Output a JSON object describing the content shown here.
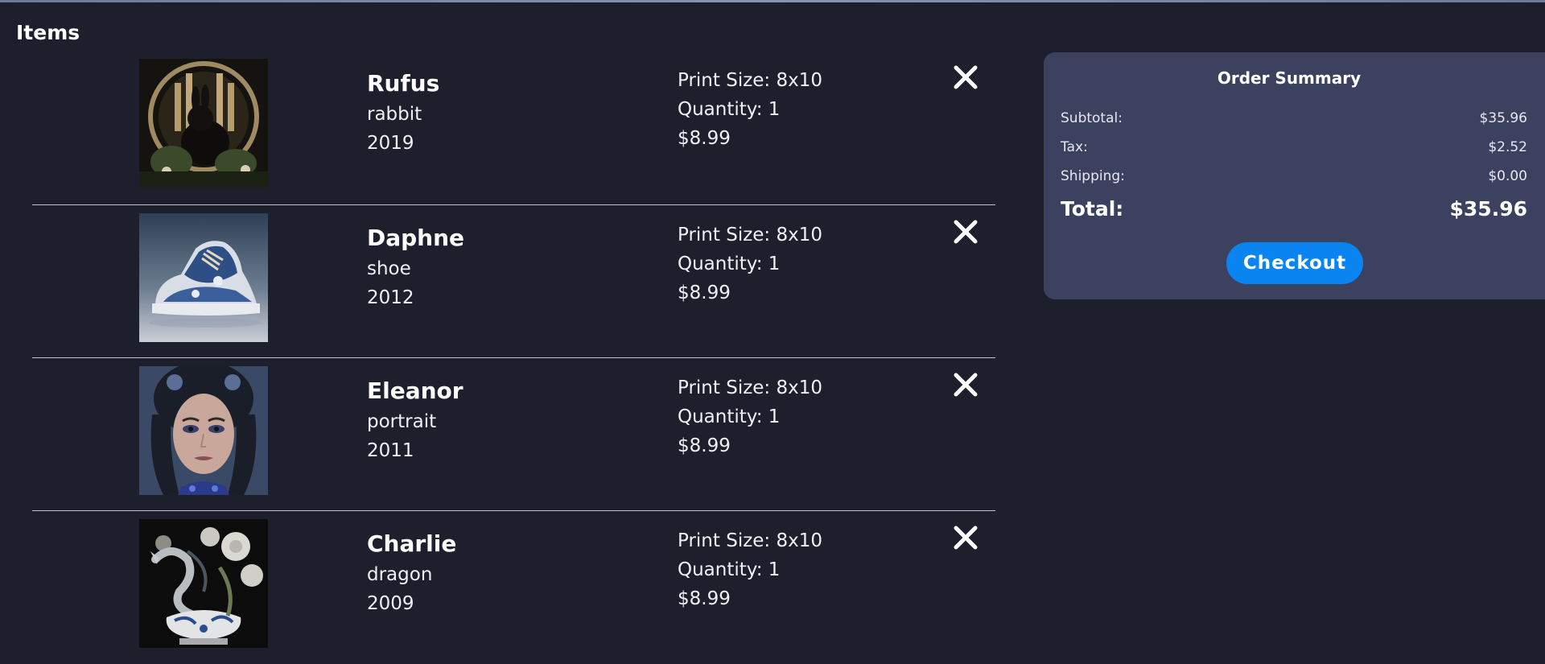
{
  "page": {
    "heading": "Items"
  },
  "items": [
    {
      "name": "Rufus",
      "subject": "rabbit",
      "year": "2019",
      "print_size": "Print Size: 8x10",
      "quantity": "Quantity: 1",
      "price": "$8.99",
      "image_icon": "rabbit-artwork"
    },
    {
      "name": "Daphne",
      "subject": "shoe",
      "year": "2012",
      "print_size": "Print Size: 8x10",
      "quantity": "Quantity: 1",
      "price": "$8.99",
      "image_icon": "shoe-artwork"
    },
    {
      "name": "Eleanor",
      "subject": "portrait",
      "year": "2011",
      "print_size": "Print Size: 8x10",
      "quantity": "Quantity: 1",
      "price": "$8.99",
      "image_icon": "portrait-artwork"
    },
    {
      "name": "Charlie",
      "subject": "dragon",
      "year": "2009",
      "print_size": "Print Size: 8x10",
      "quantity": "Quantity: 1",
      "price": "$8.99",
      "image_icon": "dragon-artwork"
    }
  ],
  "summary": {
    "title": "Order Summary",
    "subtotal_label": "Subtotal:",
    "subtotal_value": "$35.96",
    "tax_label": "Tax:",
    "tax_value": "$2.52",
    "shipping_label": "Shipping:",
    "shipping_value": "$0.00",
    "total_label": "Total:",
    "total_value": "$35.96",
    "checkout_label": "Checkout"
  },
  "colors": {
    "background": "#1e1f2c",
    "summary_panel": "#3d4160",
    "checkout_button": "#0a84f0",
    "divider": "#bfc3cc"
  }
}
